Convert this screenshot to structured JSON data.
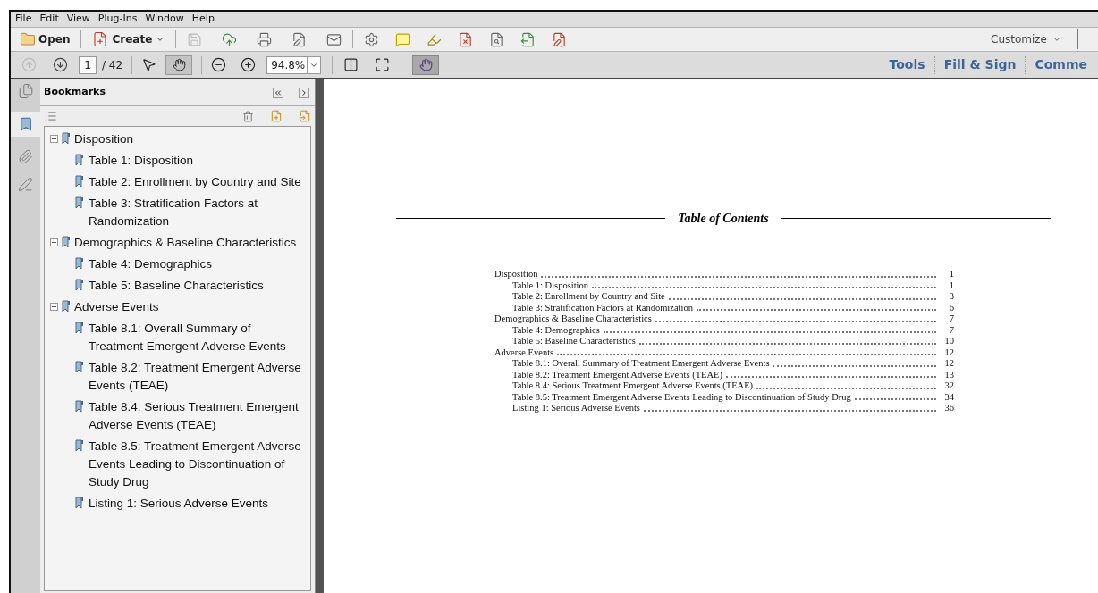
{
  "menu": [
    "File",
    "Edit",
    "View",
    "Plug-Ins",
    "Window",
    "Help"
  ],
  "toolbar": {
    "open": "Open",
    "create": "Create",
    "customize": "Customize"
  },
  "nav": {
    "page": "1",
    "total": "/ 42",
    "zoom": "94.8%"
  },
  "task_tabs": [
    "Tools",
    "Fill & Sign",
    "Comme"
  ],
  "panel": {
    "title": "Bookmarks"
  },
  "bookmarks": [
    {
      "label": "Disposition",
      "expanded": true,
      "children": [
        {
          "label": "Table 1: Disposition"
        },
        {
          "label": "Table 2: Enrollment by Country and Site"
        },
        {
          "label": "Table 3: Stratification Factors at Randomization"
        }
      ]
    },
    {
      "label": "Demographics & Baseline Characteristics",
      "expanded": true,
      "children": [
        {
          "label": "Table 4: Demographics"
        },
        {
          "label": "Table 5: Baseline Characteristics"
        }
      ]
    },
    {
      "label": "Adverse Events",
      "expanded": true,
      "children": [
        {
          "label": "Table 8.1: Overall Summary of Treatment Emergent Adverse Events"
        },
        {
          "label": "Table 8.2: Treatment Emergent Adverse Events (TEAE)"
        },
        {
          "label": "Table 8.4: Serious Treatment Emergent Adverse Events (TEAE)"
        },
        {
          "label": "Table 8.5: Treatment Emergent Adverse Events Leading to Discontinuation of Study Drug"
        },
        {
          "label": "Listing 1: Serious Adverse Events"
        }
      ]
    }
  ],
  "document": {
    "heading": "Table of Contents",
    "toc": [
      {
        "title": "Disposition",
        "page": "1",
        "children": [
          {
            "title": "Table 1: Disposition",
            "page": "1"
          },
          {
            "title": "Table 2: Enrollment by Country and Site",
            "page": "3"
          },
          {
            "title": "Table 3: Stratification Factors at Randomization",
            "page": "6"
          }
        ]
      },
      {
        "title": "Demographics & Baseline Characteristics",
        "page": "7",
        "children": [
          {
            "title": "Table 4: Demographics",
            "page": "7"
          },
          {
            "title": "Table 5: Baseline Characteristics",
            "page": "10"
          }
        ]
      },
      {
        "title": "Adverse Events",
        "page": "12",
        "children": [
          {
            "title": "Table 8.1: Overall Summary of Treatment Emergent Adverse Events",
            "page": "12"
          },
          {
            "title": "Table 8.2: Treatment Emergent Adverse Events (TEAE)",
            "page": "13"
          },
          {
            "title": "Table 8.4: Serious Treatment Emergent Adverse Events (TEAE)",
            "page": "32"
          },
          {
            "title": "Table 8.5: Treatment Emergent Adverse Events Leading to Discontinuation of Study Drug",
            "page": "34"
          },
          {
            "title": "Listing 1: Serious Adverse Events",
            "page": "36"
          }
        ]
      }
    ]
  }
}
